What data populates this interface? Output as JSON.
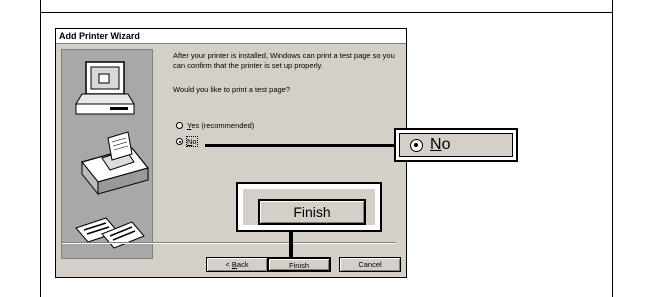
{
  "window": {
    "title": "Add Printer Wizard"
  },
  "content": {
    "paragraph1": "After your printer is installed, Windows can print a test page so you can confirm that the printer is set up properly.",
    "question": "Would you like to print a test page?",
    "options": [
      {
        "label": "Yes (recommended)",
        "accel": "Y",
        "rest": "es (recommended)",
        "selected": false
      },
      {
        "label": "No",
        "accel": "N",
        "rest": "o",
        "selected": true
      }
    ]
  },
  "buttons": {
    "back": {
      "accel": "B",
      "label_prefix": "< ",
      "rest": "ack"
    },
    "finish": "Finish",
    "cancel": "Cancel"
  },
  "callouts": {
    "no": {
      "accel": "N",
      "rest": "o"
    },
    "finish": "Finish"
  }
}
